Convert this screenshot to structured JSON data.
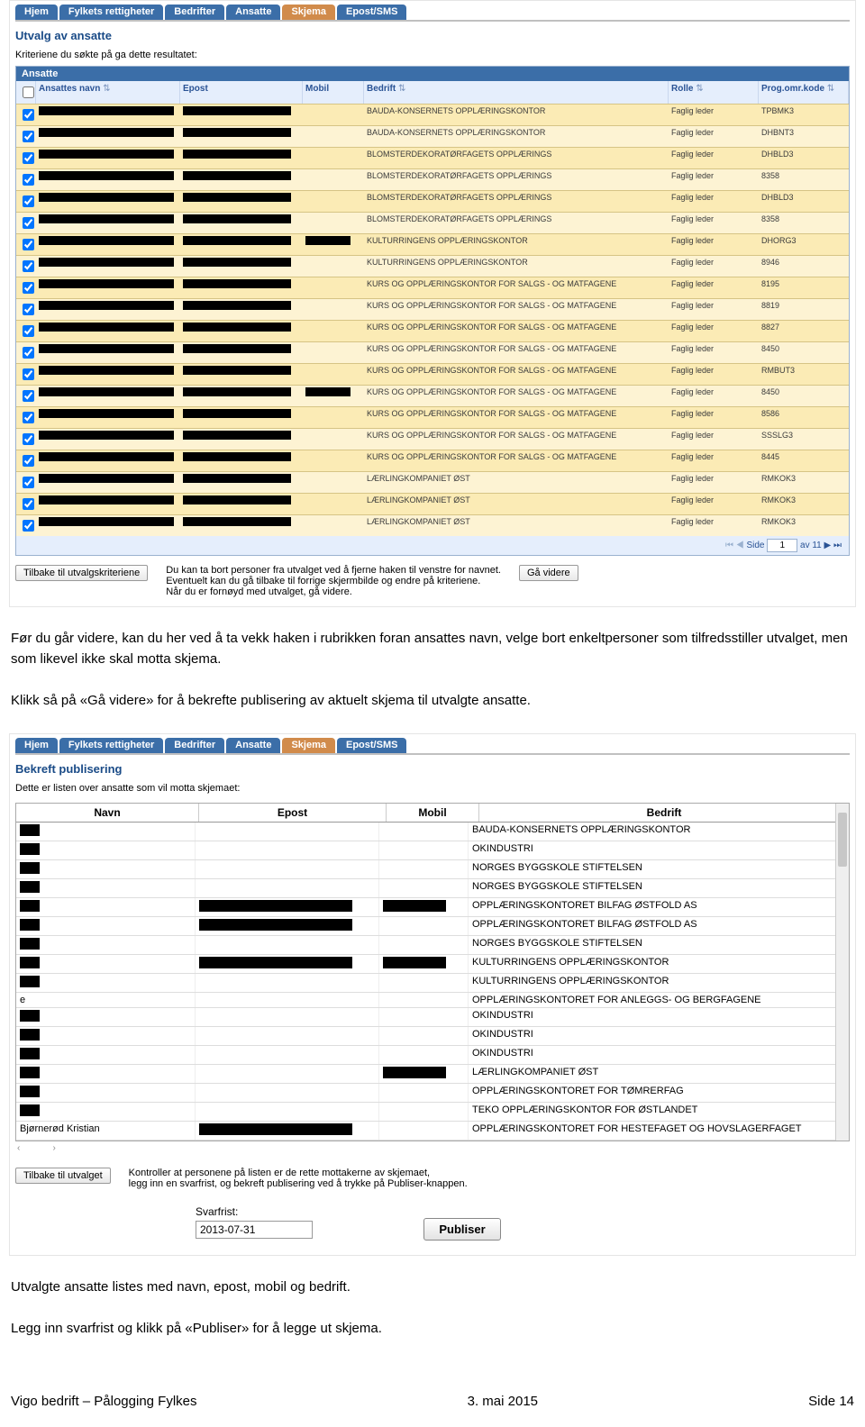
{
  "tabs": [
    "Hjem",
    "Fylkets rettigheter",
    "Bedrifter",
    "Ansatte",
    "Skjema",
    "Epost/SMS"
  ],
  "s1": {
    "title": "Utvalg av ansatte",
    "subtitle": "Kriteriene du søkte på ga dette resultatet:",
    "tableTitle": "Ansatte",
    "headers": {
      "navn": "Ansattes navn",
      "epost": "Epost",
      "mobil": "Mobil",
      "bedrift": "Bedrift",
      "rolle": "Rolle",
      "prog": "Prog.omr.kode"
    },
    "rows": [
      {
        "bedrift": "BAUDA-KONSERNETS OPPLÆRINGSKONTOR",
        "rolle": "Faglig leder",
        "prog": "TPBMK3",
        "mob": false
      },
      {
        "bedrift": "BAUDA-KONSERNETS OPPLÆRINGSKONTOR",
        "rolle": "Faglig leder",
        "prog": "DHBNT3",
        "mob": false
      },
      {
        "bedrift": "BLOMSTERDEKORATØRFAGETS OPPLÆRINGS",
        "rolle": "Faglig leder",
        "prog": "DHBLD3",
        "mob": false
      },
      {
        "bedrift": "BLOMSTERDEKORATØRFAGETS OPPLÆRINGS",
        "rolle": "Faglig leder",
        "prog": "8358",
        "mob": false
      },
      {
        "bedrift": "BLOMSTERDEKORATØRFAGETS OPPLÆRINGS",
        "rolle": "Faglig leder",
        "prog": "DHBLD3",
        "mob": false
      },
      {
        "bedrift": "BLOMSTERDEKORATØRFAGETS OPPLÆRINGS",
        "rolle": "Faglig leder",
        "prog": "8358",
        "mob": false
      },
      {
        "bedrift": "KULTURRINGENS OPPLÆRINGSKONTOR",
        "rolle": "Faglig leder",
        "prog": "DHORG3",
        "mob": true
      },
      {
        "bedrift": "KULTURRINGENS OPPLÆRINGSKONTOR",
        "rolle": "Faglig leder",
        "prog": "8946",
        "mob": false
      },
      {
        "bedrift": "KURS OG OPPLÆRINGSKONTOR FOR SALGS - OG MATFAGENE",
        "rolle": "Faglig leder",
        "prog": "8195",
        "mob": false
      },
      {
        "bedrift": "KURS OG OPPLÆRINGSKONTOR FOR SALGS - OG MATFAGENE",
        "rolle": "Faglig leder",
        "prog": "8819",
        "mob": false
      },
      {
        "bedrift": "KURS OG OPPLÆRINGSKONTOR FOR SALGS - OG MATFAGENE",
        "rolle": "Faglig leder",
        "prog": "8827",
        "mob": false
      },
      {
        "bedrift": "KURS OG OPPLÆRINGSKONTOR FOR SALGS - OG MATFAGENE",
        "rolle": "Faglig leder",
        "prog": "8450",
        "mob": false
      },
      {
        "bedrift": "KURS OG OPPLÆRINGSKONTOR FOR SALGS - OG MATFAGENE",
        "rolle": "Faglig leder",
        "prog": "RMBUT3",
        "mob": false
      },
      {
        "bedrift": "KURS OG OPPLÆRINGSKONTOR FOR SALGS - OG MATFAGENE",
        "rolle": "Faglig leder",
        "prog": "8450",
        "mob": true
      },
      {
        "bedrift": "KURS OG OPPLÆRINGSKONTOR FOR SALGS - OG MATFAGENE",
        "rolle": "Faglig leder",
        "prog": "8586",
        "mob": false
      },
      {
        "bedrift": "KURS OG OPPLÆRINGSKONTOR FOR SALGS - OG MATFAGENE",
        "rolle": "Faglig leder",
        "prog": "SSSLG3",
        "mob": false
      },
      {
        "bedrift": "KURS OG OPPLÆRINGSKONTOR FOR SALGS - OG MATFAGENE",
        "rolle": "Faglig leder",
        "prog": "8445",
        "mob": false
      },
      {
        "bedrift": "LÆRLINGKOMPANIET ØST",
        "rolle": "Faglig leder",
        "prog": "RMKOK3",
        "mob": false
      },
      {
        "bedrift": "LÆRLINGKOMPANIET ØST",
        "rolle": "Faglig leder",
        "prog": "RMKOK3",
        "mob": false
      },
      {
        "bedrift": "LÆRLINGKOMPANIET ØST",
        "rolle": "Faglig leder",
        "prog": "RMKOK3",
        "mob": false
      }
    ],
    "pager": {
      "sideLabel": "Side",
      "page": "1",
      "avLabel": "av 11"
    },
    "btnBack": "Tilbake til utvalgskriteriene",
    "helpText": "Du kan ta bort personer fra utvalget ved å fjerne haken til venstre for navnet.\nEventuelt kan du gå tilbake til forrige skjermbilde og endre på kriteriene.\nNår du er fornøyd med utvalget, gå videre.",
    "btnForward": "Gå videre"
  },
  "para1": "Før du går videre, kan du her ved å ta vekk haken i rubrikken foran ansattes navn, velge bort enkeltpersoner som tilfredsstiller utvalget, men som likevel ikke skal motta skjema.",
  "para2": "Klikk så på «Gå videre» for å bekrefte publisering av aktuelt skjema til utvalgte ansatte.",
  "s2": {
    "title": "Bekreft publisering",
    "subtitle": "Dette er listen over ansatte som vil motta skjemaet:",
    "headers": {
      "navn": "Navn",
      "epost": "Epost",
      "mobil": "Mobil",
      "bedrift": "Bedrift"
    },
    "rows": [
      {
        "navn": "",
        "bedrift": "BAUDA-KONSERNETS OPPLÆRINGSKONTOR",
        "ep": false,
        "mob": false
      },
      {
        "navn": "",
        "bedrift": "OKINDUSTRI",
        "ep": false,
        "mob": false
      },
      {
        "navn": "",
        "bedrift": "NORGES BYGGSKOLE STIFTELSEN",
        "ep": false,
        "mob": false
      },
      {
        "navn": "",
        "bedrift": "NORGES BYGGSKOLE STIFTELSEN",
        "ep": false,
        "mob": false
      },
      {
        "navn": "",
        "bedrift": "OPPLÆRINGSKONTORET BILFAG ØSTFOLD AS",
        "ep": true,
        "mob": true
      },
      {
        "navn": "",
        "bedrift": "OPPLÆRINGSKONTORET BILFAG ØSTFOLD AS",
        "ep": true,
        "mob": false
      },
      {
        "navn": "",
        "bedrift": "NORGES BYGGSKOLE STIFTELSEN",
        "ep": false,
        "mob": false
      },
      {
        "navn": "",
        "bedrift": "KULTURRINGENS OPPLÆRINGSKONTOR",
        "ep": true,
        "mob": true
      },
      {
        "navn": "",
        "bedrift": "KULTURRINGENS OPPLÆRINGSKONTOR",
        "ep": false,
        "mob": false
      },
      {
        "navn": "e",
        "bedrift": "OPPLÆRINGSKONTORET FOR ANLEGGS- OG BERGFAGENE",
        "ep": false,
        "mob": false
      },
      {
        "navn": "",
        "bedrift": "OKINDUSTRI",
        "ep": false,
        "mob": false
      },
      {
        "navn": "",
        "bedrift": "OKINDUSTRI",
        "ep": false,
        "mob": false
      },
      {
        "navn": "",
        "bedrift": "OKINDUSTRI",
        "ep": false,
        "mob": false
      },
      {
        "navn": "",
        "bedrift": "LÆRLINGKOMPANIET ØST",
        "ep": false,
        "mob": true
      },
      {
        "navn": "",
        "bedrift": "OPPLÆRINGSKONTORET FOR TØMRERFAG",
        "ep": false,
        "mob": false
      },
      {
        "navn": "",
        "bedrift": "TEKO OPPLÆRINGSKONTOR FOR ØSTLANDET",
        "ep": false,
        "mob": false
      },
      {
        "navn": "Bjørnerød Kristian",
        "bedrift": "OPPLÆRINGSKONTORET FOR HESTEFAGET OG HOVSLAGERFAGET",
        "ep": true,
        "mob": false
      }
    ],
    "btnBack": "Tilbake til utvalget",
    "helpText": "Kontroller at personene på listen er de rette mottakerne av skjemaet,\nlegg inn en svarfrist, og bekreft publisering ved å trykke på Publiser-knappen.",
    "svarfristLabel": "Svarfrist:",
    "svarfristValue": "2013-07-31",
    "btnPublish": "Publiser"
  },
  "para3": "Utvalgte ansatte listes med navn, epost, mobil og bedrift.",
  "para4": "Legg inn svarfrist og klikk på «Publiser» for å legge ut skjema.",
  "footer": {
    "left": "Vigo bedrift – Pålogging Fylkes",
    "mid": "3. mai 2015",
    "right": "Side 14"
  }
}
